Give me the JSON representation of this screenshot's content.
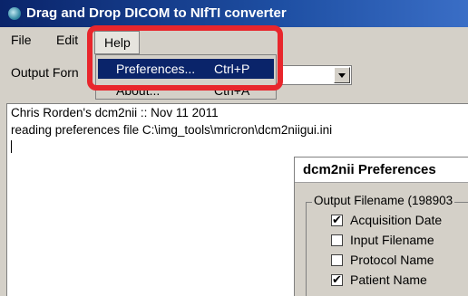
{
  "window": {
    "title": "Drag and Drop DICOM to NIfTI converter"
  },
  "menubar": {
    "items": [
      {
        "label": "File"
      },
      {
        "label": "Edit"
      },
      {
        "label": "Help"
      }
    ]
  },
  "output_format": {
    "label": "Output Forn"
  },
  "help_menu": {
    "items": [
      {
        "label": "Preferences...",
        "shortcut": "Ctrl+P",
        "selected": true
      },
      {
        "label": "About...",
        "shortcut": "Ctrl+A",
        "selected": false
      }
    ]
  },
  "log": {
    "lines": [
      "Chris Rorden's dcm2nii :: Nov 11 2011",
      "reading preferences file C:\\img_tools\\mricron\\dcm2niigui.ini"
    ]
  },
  "preferences_dialog": {
    "title": "dcm2nii Preferences",
    "group_label": "Output Filename (198903",
    "options": [
      {
        "label": "Acquisition Date",
        "checked": true
      },
      {
        "label": "Input Filename",
        "checked": false
      },
      {
        "label": "Protocol Name",
        "checked": false
      },
      {
        "label": "Patient Name",
        "checked": true
      }
    ]
  },
  "colors": {
    "highlight": "#e8262c",
    "title_bar": "#0a246a",
    "menu_selection": "#0a246a"
  }
}
